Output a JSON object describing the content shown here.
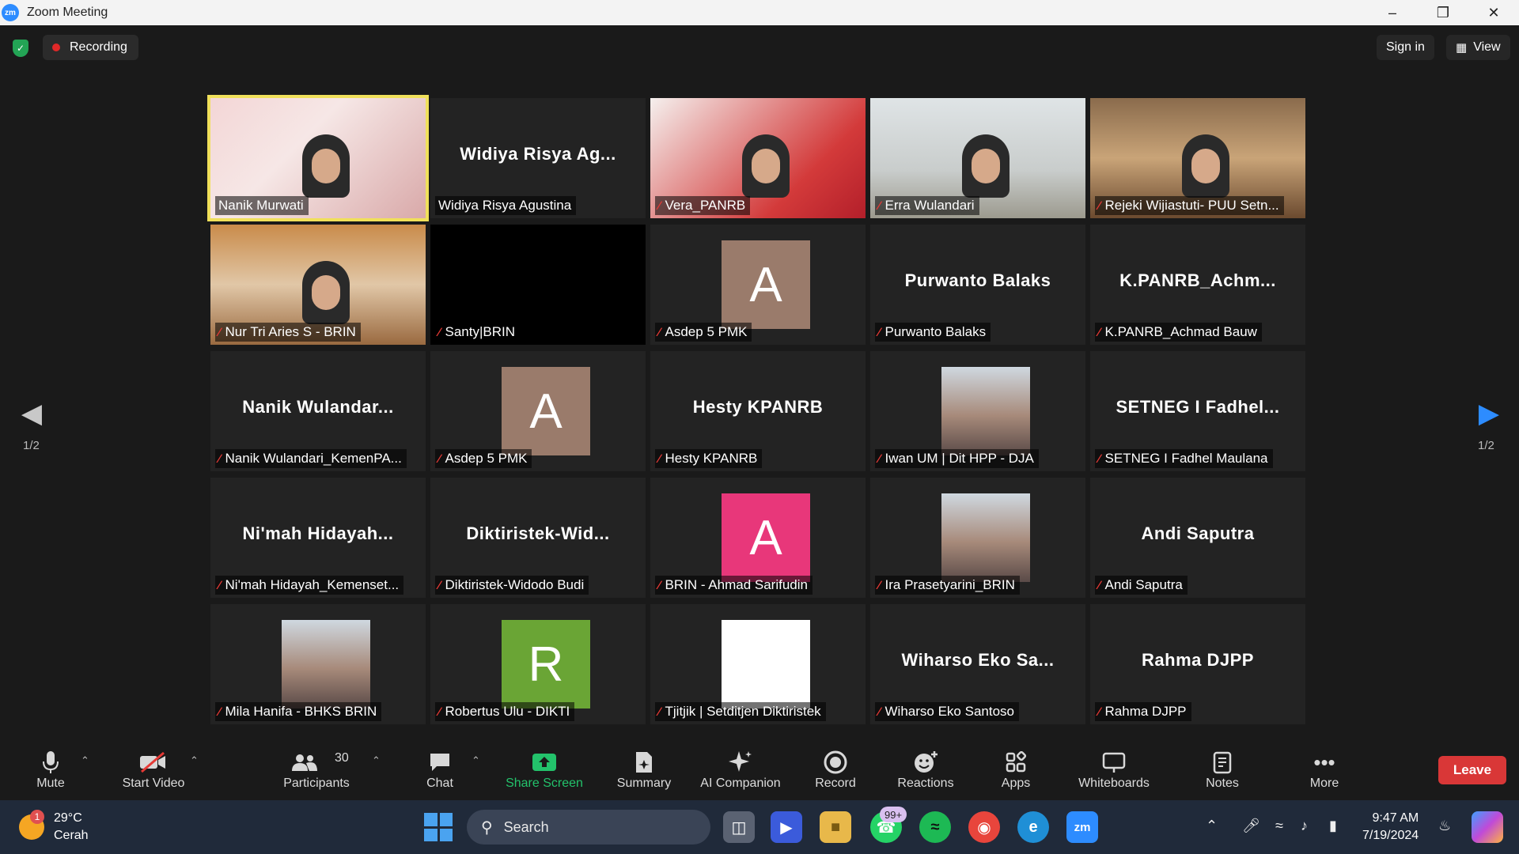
{
  "window": {
    "title": "Zoom Meeting",
    "logo_text": "zm"
  },
  "meeting_bar": {
    "recording_label": "Recording",
    "sign_in_label": "Sign in",
    "view_label": "View"
  },
  "pager": {
    "left": "1/2",
    "right": "1/2"
  },
  "tiles": [
    {
      "label": "Nanik Murwati",
      "big": "",
      "kind": "video",
      "muted": false,
      "active": true
    },
    {
      "label": "Widiya Risya Agustina",
      "big": "Widiya Risya Ag...",
      "kind": "name",
      "muted": false,
      "active": false
    },
    {
      "label": "Vera_PANRB",
      "big": "",
      "kind": "video",
      "muted": true,
      "active": false
    },
    {
      "label": "Erra Wulandari",
      "big": "",
      "kind": "video",
      "muted": true,
      "active": false
    },
    {
      "label": "Rejeki Wijiastuti- PUU Setn...",
      "big": "",
      "kind": "video",
      "muted": true,
      "active": false
    },
    {
      "label": "Nur Tri Aries S - BRIN",
      "big": "",
      "kind": "video",
      "muted": true,
      "active": false
    },
    {
      "label": "Santy|BRIN",
      "big": "",
      "kind": "black",
      "muted": true,
      "active": false
    },
    {
      "label": "Asdep 5 PMK",
      "big": "",
      "kind": "avatar",
      "avatar": "A",
      "avatar_color": "#9a7b6b",
      "muted": true,
      "active": false
    },
    {
      "label": "Purwanto Balaks",
      "big": "Purwanto Balaks",
      "kind": "name",
      "muted": true,
      "active": false
    },
    {
      "label": "K.PANRB_Achmad Bauw",
      "big": "K.PANRB_Achm...",
      "kind": "name",
      "muted": true,
      "active": false
    },
    {
      "label": "Nanik Wulandari_KemenPA...",
      "big": "Nanik  Wulandar...",
      "kind": "name",
      "muted": true,
      "active": false
    },
    {
      "label": "Asdep 5 PMK",
      "big": "",
      "kind": "avatar",
      "avatar": "A",
      "avatar_color": "#9a7b6b",
      "muted": true,
      "active": false
    },
    {
      "label": "Hesty KPANRB",
      "big": "Hesty KPANRB",
      "kind": "name",
      "muted": true,
      "active": false
    },
    {
      "label": "Iwan UM | Dit HPP - DJA",
      "big": "",
      "kind": "photo",
      "muted": true,
      "active": false
    },
    {
      "label": "SETNEG I Fadhel Maulana",
      "big": "SETNEG I Fadhel...",
      "kind": "name",
      "muted": true,
      "active": false
    },
    {
      "label": "Ni'mah Hidayah_Kemenset...",
      "big": "Ni'mah  Hidayah...",
      "kind": "name",
      "muted": true,
      "active": false
    },
    {
      "label": "Diktiristek-Widodo Budi",
      "big": "Diktiristek-Wid...",
      "kind": "name",
      "muted": true,
      "active": false
    },
    {
      "label": "BRIN - Ahmad Sarifudin",
      "big": "",
      "kind": "avatar",
      "avatar": "A",
      "avatar_color": "#e8377a",
      "muted": true,
      "active": false
    },
    {
      "label": "Ira Prasetyarini_BRIN",
      "big": "",
      "kind": "photo",
      "muted": true,
      "active": false
    },
    {
      "label": "Andi Saputra",
      "big": "Andi Saputra",
      "kind": "name",
      "muted": true,
      "active": false
    },
    {
      "label": "Mila Hanifa - BHKS BRIN",
      "big": "",
      "kind": "photo",
      "muted": true,
      "active": false
    },
    {
      "label": "Robertus Ulu - DIKTI",
      "big": "",
      "kind": "avatar",
      "avatar": "R",
      "avatar_color": "#6aa535",
      "muted": true,
      "active": false
    },
    {
      "label": "Tjitjik | Setditjen Diktiristek",
      "big": "",
      "kind": "avatar",
      "avatar": "",
      "avatar_color": "#ffffff",
      "muted": true,
      "active": false
    },
    {
      "label": "Wiharso Eko Santoso",
      "big": "Wiharso  Eko  Sa...",
      "kind": "name",
      "muted": true,
      "active": false
    },
    {
      "label": "Rahma DJPP",
      "big": "Rahma DJPP",
      "kind": "name",
      "muted": true,
      "active": false
    }
  ],
  "toolbar": {
    "mute": "Mute",
    "start_video": "Start Video",
    "participants": "Participants",
    "participants_count": "30",
    "chat": "Chat",
    "share_screen": "Share Screen",
    "summary": "Summary",
    "ai_companion": "AI Companion",
    "record": "Record",
    "reactions": "Reactions",
    "apps": "Apps",
    "whiteboards": "Whiteboards",
    "notes": "Notes",
    "more": "More",
    "leave": "Leave"
  },
  "taskbar": {
    "weather_temp": "29°C",
    "weather_desc": "Cerah",
    "weather_badge": "1",
    "search_label": "Search",
    "whatsapp_badge": "99+",
    "time": "9:47 AM",
    "date": "7/19/2024"
  },
  "colors": {
    "accent": "#2d8cff",
    "share_green": "#23c26b",
    "leave_red": "#d93737",
    "active_speaker": "#f0e05a"
  }
}
